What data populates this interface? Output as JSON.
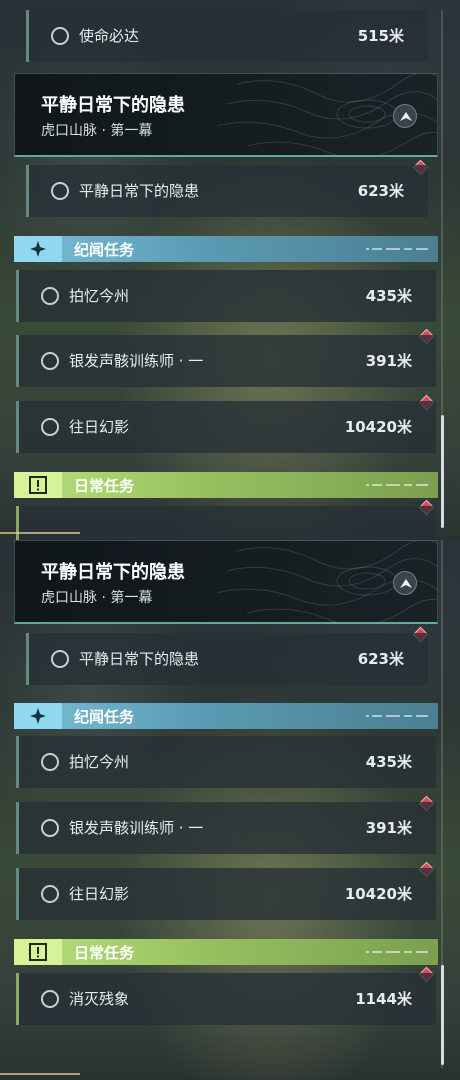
{
  "top_row": {
    "name": "使命必达",
    "distance": "515米"
  },
  "main_quest": {
    "title": "平静日常下的隐患",
    "subtitle": "虎口山脉 · 第一幕"
  },
  "main_quest_row": {
    "name": "平静日常下的隐患",
    "distance": "623米"
  },
  "side_section": {
    "label": "纪闻任务",
    "icon": "sparkle-icon",
    "color": "#79bfd6"
  },
  "side_quests": [
    {
      "name": "拍忆今州",
      "distance": "435米"
    },
    {
      "name": "银发声骸训练师 · 一",
      "distance": "391米"
    },
    {
      "name": "往日幻影",
      "distance": "10420米"
    }
  ],
  "daily_section": {
    "label": "日常任务",
    "icon": "alert-icon",
    "color": "#b8e07a"
  },
  "daily_quests": [
    {
      "name": "消灭残象",
      "distance": "1144米"
    }
  ],
  "accent_marker_color": "#d9485a"
}
